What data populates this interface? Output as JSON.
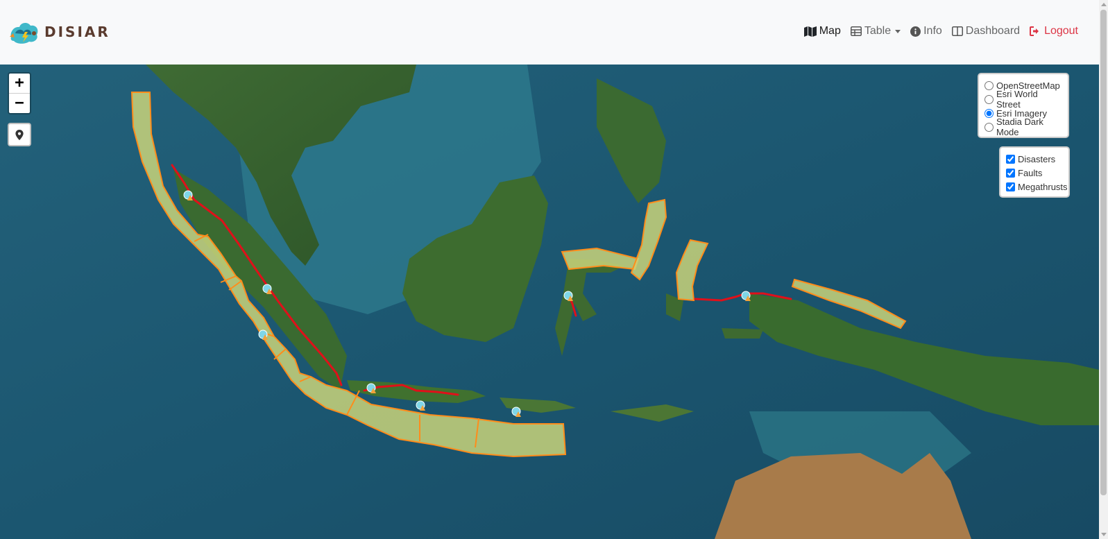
{
  "brand": {
    "name": "DISIAR"
  },
  "nav": {
    "map": "Map",
    "table": "Table",
    "info": "Info",
    "dashboard": "Dashboard",
    "logout": "Logout",
    "logout_color": "#dc3545"
  },
  "map_controls": {
    "zoom_in": "+",
    "zoom_out": "−",
    "locate_icon": "map-marker-icon"
  },
  "base_layers": [
    {
      "label": "OpenStreetMap",
      "checked": false
    },
    {
      "label": "Esri World Street",
      "checked": false
    },
    {
      "label": "Esri Imagery",
      "checked": true
    },
    {
      "label": "Stadia Dark Mode",
      "checked": false
    }
  ],
  "overlays": [
    {
      "label": "Disasters",
      "checked": true
    },
    {
      "label": "Faults",
      "checked": true
    },
    {
      "label": "Megathrusts",
      "checked": true
    }
  ],
  "colors": {
    "megathrust_fill": "#c9d47a",
    "megathrust_stroke": "#ff8c1a",
    "fault_line": "#e0101a",
    "disaster_marker": "#7fd6e8"
  }
}
